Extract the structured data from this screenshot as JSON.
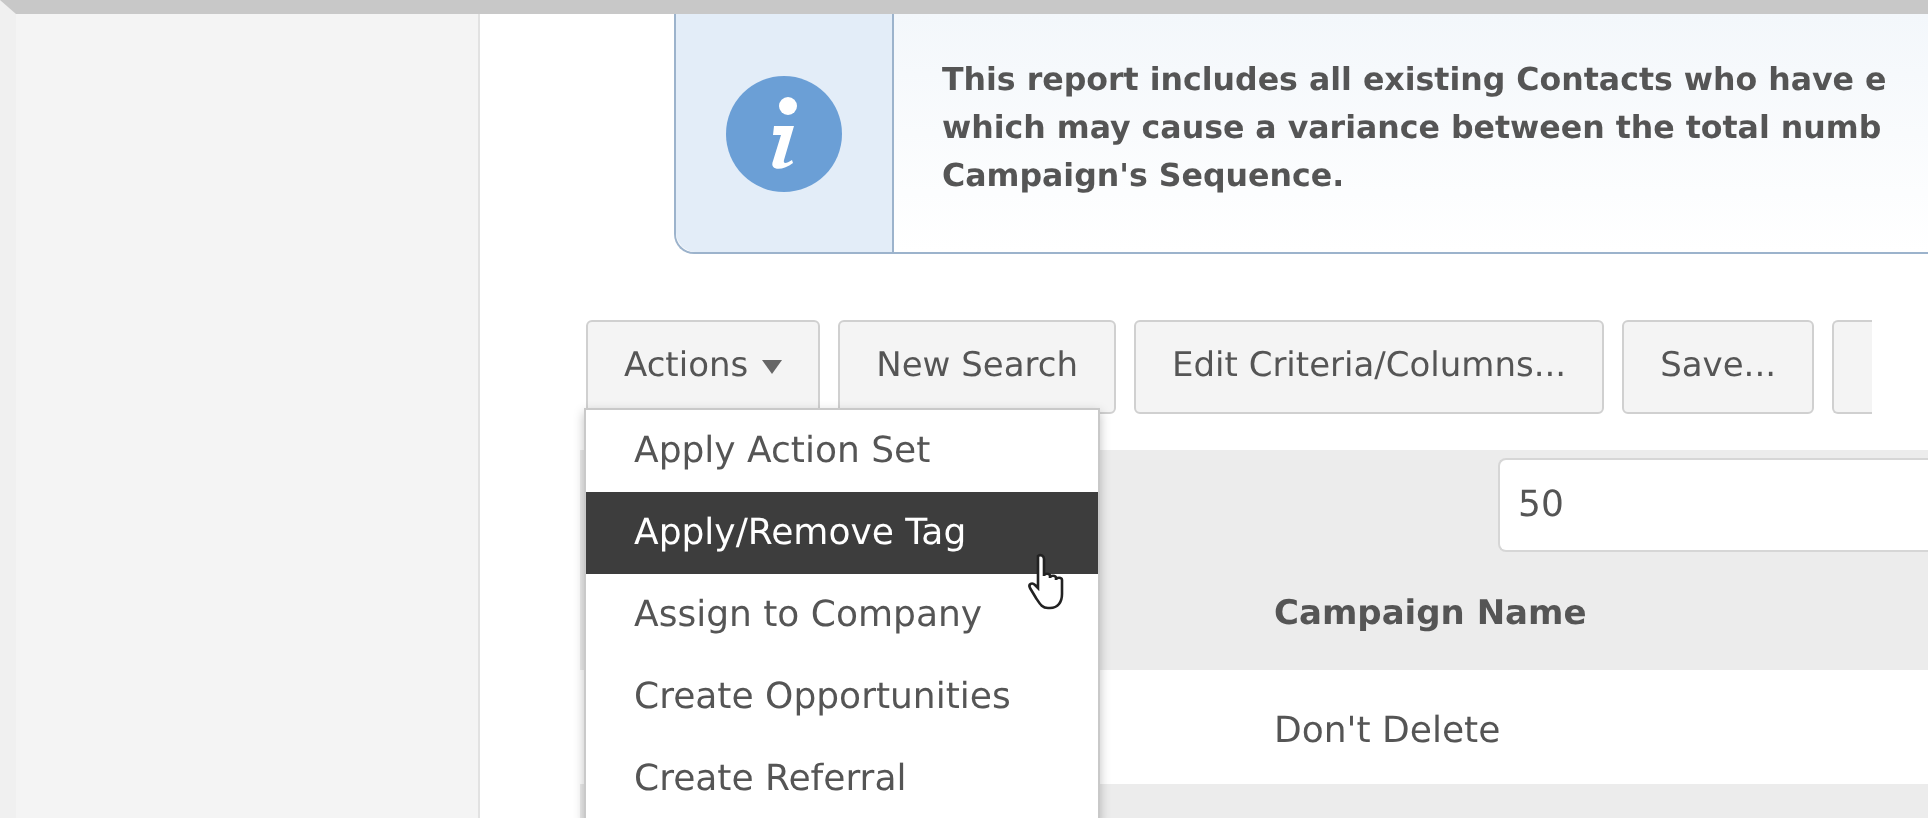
{
  "notice": {
    "lines": [
      "This report includes all existing Contacts who have e",
      "which may cause a variance between the total numb",
      "Campaign's Sequence."
    ]
  },
  "toolbar": {
    "buttons": [
      {
        "label": "Actions",
        "kind": "dropdown"
      },
      {
        "label": "New Search",
        "kind": "plain"
      },
      {
        "label": "Edit Criteria/Columns...",
        "kind": "plain"
      },
      {
        "label": "Save...",
        "kind": "plain"
      },
      {
        "kind": "cut"
      }
    ]
  },
  "actions_menu": {
    "items": [
      {
        "label": "Apply Action Set",
        "selected": false
      },
      {
        "label": "Apply/Remove Tag",
        "selected": true
      },
      {
        "label": "Assign to Company",
        "selected": false
      },
      {
        "label": "Create Opportunities",
        "selected": false
      },
      {
        "label": "Create Referral",
        "selected": false
      }
    ]
  },
  "page_size": {
    "value": "50"
  },
  "table": {
    "columns": [
      "Campaign Name"
    ],
    "rows": [
      [
        "Don't Delete"
      ]
    ]
  }
}
